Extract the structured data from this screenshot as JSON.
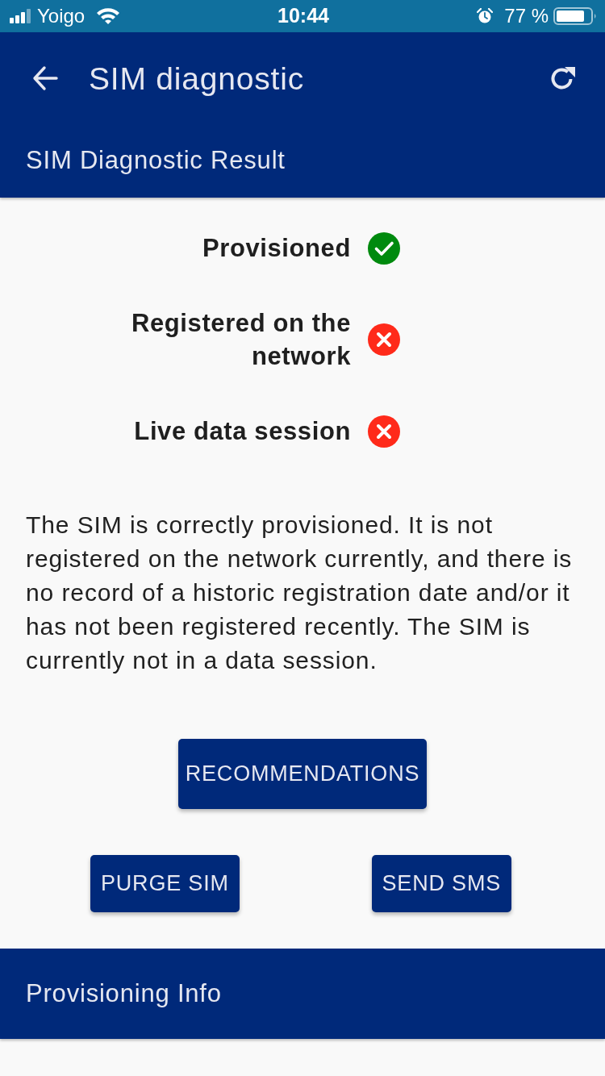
{
  "status_bar": {
    "carrier": "Yoigo",
    "time": "10:44",
    "battery_text": "77 %"
  },
  "app_bar": {
    "title": "SIM diagnostic"
  },
  "section_title": "SIM Diagnostic Result",
  "checks": [
    {
      "label": "Provisioned",
      "passed": true
    },
    {
      "label": "Registered on the network",
      "passed": false
    },
    {
      "label": "Live data session",
      "passed": false
    }
  ],
  "summary": "The SIM is correctly provisioned. It is not registered on the network currently, and there is no record of a historic registration date and/or it has not been registered recently. The SIM is currently not in a data session.",
  "primary_button": "RECOMMENDATIONS",
  "action_buttons": [
    "PURGE SIM",
    "SEND SMS"
  ],
  "footer_section": {
    "title": "Provisioning Info"
  }
}
